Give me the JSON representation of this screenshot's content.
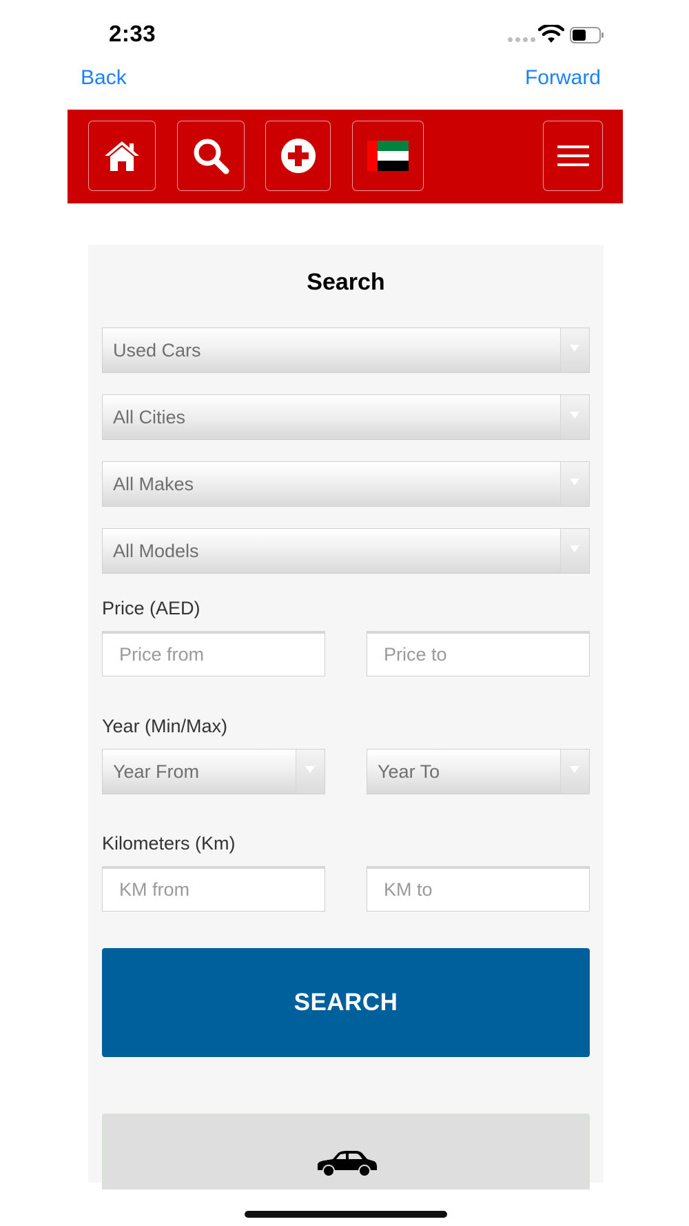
{
  "status_bar": {
    "time": "2:33"
  },
  "browser_nav": {
    "back_label": "Back",
    "forward_label": "Forward"
  },
  "toolbar": {
    "home_icon": "home-icon",
    "search_icon": "search-icon",
    "add_icon": "plus-circle-icon",
    "flag_icon": "uae-flag-icon",
    "menu_icon": "hamburger-menu-icon",
    "background_color": "#cc0000"
  },
  "search": {
    "title": "Search",
    "category": "Used Cars",
    "city": "All Cities",
    "make": "All Makes",
    "model": "All Models",
    "price_label": "Price (AED)",
    "price_from_placeholder": "Price from",
    "price_to_placeholder": "Price to",
    "year_label": "Year (Min/Max)",
    "year_from": "Year From",
    "year_to": "Year To",
    "km_label": "Kilometers (Km)",
    "km_from_placeholder": "KM from",
    "km_to_placeholder": "KM to",
    "search_button_label": "SEARCH",
    "button_color": "#00609c"
  },
  "listing_preview": {
    "icon": "car-icon"
  }
}
